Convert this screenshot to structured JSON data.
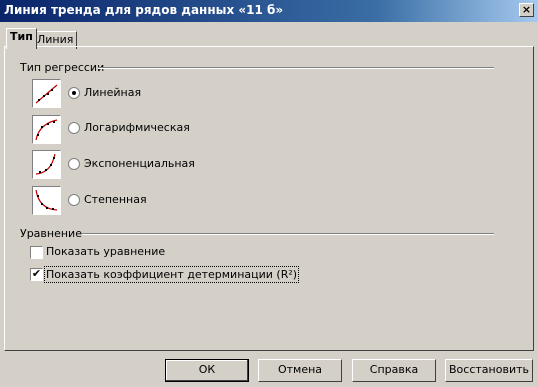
{
  "window": {
    "title": "Линия тренда для рядов данных «11 б»",
    "close_glyph": "×"
  },
  "tabs": [
    {
      "label": "Тип",
      "active": true
    },
    {
      "label": "Линия",
      "active": false
    }
  ],
  "regression": {
    "group_label": "Тип регрессии",
    "options": [
      {
        "label": "Линейная",
        "icon": "linear-regression-icon",
        "selected": true
      },
      {
        "label": "Логарифмическая",
        "icon": "logarithmic-regression-icon",
        "selected": false
      },
      {
        "label": "Экспоненциальная",
        "icon": "exponential-regression-icon",
        "selected": false
      },
      {
        "label": "Степенная",
        "icon": "power-regression-icon",
        "selected": false
      }
    ]
  },
  "equation": {
    "group_label": "Уравнение",
    "show_equation": {
      "label": "Показать уравнение",
      "checked": false
    },
    "show_r2": {
      "label": "Показать коэффициент детерминации (R²)",
      "checked": true
    }
  },
  "buttons": {
    "ok": "ОК",
    "cancel": "Отмена",
    "help": "Справка",
    "reset": "Восстановить"
  },
  "colors": {
    "title_start": "#0a246a",
    "title_end": "#a6caf0",
    "curve": "#c00000",
    "face": "#d4d0c8"
  }
}
